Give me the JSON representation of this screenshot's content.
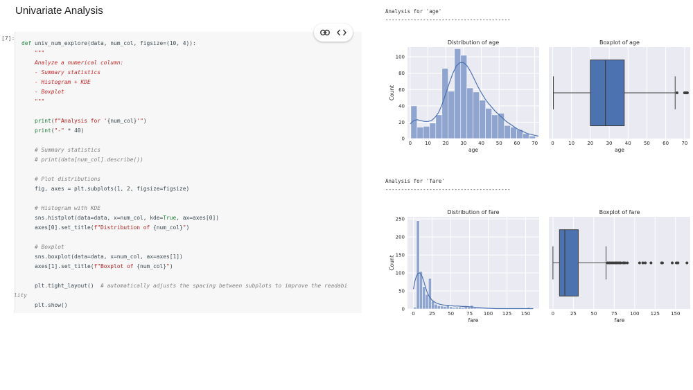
{
  "heading": "Univariate Analysis",
  "cell": {
    "execution_count": "[7]:",
    "code_lines": [
      "<span class=\"kw\">def</span> univ_num_explore(data, num_col, figsize=(10, 4)):",
      "    <span class=\"doc\">\"\"\"</span>",
      "    <span class=\"doc\">Analyze a numerical column:</span>",
      "    <span class=\"doc\">- Summary statistics</span>",
      "    <span class=\"doc\">- Histogram + KDE</span>",
      "    <span class=\"doc\">- Boxplot</span>",
      "    <span class=\"doc\">\"\"\"</span>",
      "",
      "    <span class=\"kw\">print</span>(<span class=\"str\">f\"Analysis for '</span>{num_col}<span class=\"str\">'\"</span>)",
      "    <span class=\"kw\">print</span>(<span class=\"str\">\"-\"</span> * 40)",
      "",
      "    <span class=\"cmt\"># Summary statistics</span>",
      "    <span class=\"cmt\"># print(data[num_col].describe())</span>",
      "",
      "    <span class=\"cmt\"># Plot distributions</span>",
      "    fig, axes = plt.subplots(1, 2, figsize=figsize)",
      "",
      "    <span class=\"cmt\"># Histogram with KDE</span>",
      "    sns.histplot(data=data, x=num_col, kde=<span class=\"kw\">True</span>, ax=axes[0])",
      "    axes[0].set_title(<span class=\"str\">f\"Distribution of </span>{num_col}<span class=\"str\">\"</span>)",
      "",
      "    <span class=\"cmt\"># Boxplot</span>",
      "    sns.boxplot(data=data, x=num_col, ax=axes[1])",
      "    axes[1].set_title(<span class=\"str\">f\"Boxplot of </span>{num_col}<span class=\"str\">\"</span>)",
      "",
      "    plt.tight_layout()  <span class=\"cmt\"># automatically adjusts the spacing between subplots to improve the readabi</span>",
      "<span class=\"cmt\">lity</span>",
      "    plt.show()"
    ],
    "toolbar": {
      "link_icon": "link-icon",
      "code_icon": "code-icon"
    }
  },
  "outputs": {
    "age_title": "Analysis for 'age'",
    "age_rule": "----------------------------------------",
    "fare_title": "Analysis for 'fare'",
    "fare_rule": "----------------------------------------"
  },
  "colors": {
    "bar": "#8fa4cf",
    "box": "#4c72b0",
    "kde": "#4c72b0",
    "bg": "#eaeaf2"
  },
  "chart_data": [
    {
      "type": "bar",
      "title": "Distribution of age",
      "xlabel": "age",
      "ylabel": "Count",
      "xlim": [
        -1.5,
        72.5
      ],
      "ylim": [
        0,
        112
      ],
      "xticks": [
        0,
        10,
        20,
        30,
        40,
        50,
        60,
        70
      ],
      "yticks": [
        0,
        20,
        40,
        60,
        80,
        100
      ],
      "bin_width": 3.5,
      "bin_start": 0.4,
      "values": [
        40,
        14,
        15,
        19,
        29,
        86,
        58,
        110,
        102,
        62,
        57,
        47,
        37,
        29,
        31,
        16,
        14,
        11,
        6,
        3
      ],
      "kde_x": [
        0,
        2,
        4,
        6,
        8,
        10,
        12,
        14,
        16,
        18,
        20,
        22,
        24,
        26,
        28,
        30,
        32,
        34,
        36,
        38,
        40,
        42,
        44,
        46,
        48,
        50,
        52,
        54,
        56,
        58,
        60,
        62,
        64,
        66,
        68,
        70,
        72
      ],
      "kde_y": [
        18,
        22,
        23,
        22,
        21,
        21,
        22,
        26,
        32,
        42,
        55,
        68,
        80,
        89,
        93,
        93,
        89,
        82,
        73,
        64,
        56,
        49,
        43,
        38,
        33,
        29,
        25,
        21,
        18,
        15,
        12,
        10,
        8,
        6,
        5,
        4,
        3
      ],
      "grid": true
    },
    {
      "type": "boxplot",
      "title": "Boxplot of age",
      "xlabel": "age",
      "xlim": [
        -2,
        73
      ],
      "xticks": [
        0,
        10,
        20,
        30,
        40,
        50,
        60,
        70
      ],
      "whisker_low": 0.4,
      "q1": 20,
      "median": 28,
      "q3": 38,
      "whisker_high": 65,
      "outliers": [
        66,
        70,
        70.5,
        71,
        71.5
      ],
      "grid": true
    },
    {
      "type": "bar",
      "title": "Distribution of fare",
      "xlabel": "fare",
      "ylabel": "Count",
      "xlim": [
        -8,
        168
      ],
      "ylim": [
        0,
        256
      ],
      "xticks": [
        0,
        25,
        50,
        75,
        100,
        125,
        150
      ],
      "yticks": [
        0,
        50,
        100,
        150,
        200,
        250
      ],
      "bin_width": 4,
      "bin_start": 0,
      "values": [
        5,
        245,
        104,
        62,
        40,
        85,
        22,
        13,
        9,
        8,
        7,
        12,
        6,
        4,
        5,
        5,
        4,
        7,
        5,
        10,
        3,
        2,
        2,
        2,
        3,
        1,
        1,
        1,
        1,
        1,
        1,
        1,
        1,
        1,
        1,
        1,
        1,
        2,
        4
      ],
      "kde_x": [
        0,
        2,
        4,
        6,
        8,
        10,
        12,
        14,
        16,
        18,
        20,
        25,
        30,
        35,
        40,
        45,
        50,
        55,
        60,
        65,
        70,
        75,
        80,
        85,
        90,
        100,
        110,
        120,
        130,
        140,
        150,
        160
      ],
      "kde_y": [
        55,
        78,
        92,
        98,
        100,
        97,
        88,
        75,
        61,
        48,
        38,
        24,
        17,
        13,
        11,
        10,
        9,
        8,
        8,
        7,
        7,
        6,
        5,
        4,
        3,
        2,
        1,
        1,
        1,
        1,
        1,
        1
      ],
      "grid": true
    },
    {
      "type": "boxplot",
      "title": "Boxplot of fare",
      "xlabel": "fare",
      "xlim": [
        -5,
        168
      ],
      "xticks": [
        0,
        25,
        50,
        75,
        100,
        125,
        150
      ],
      "whisker_low": 0,
      "q1": 8,
      "median": 14.5,
      "q3": 31,
      "whisker_high": 65,
      "outliers": [
        67,
        69,
        71,
        73,
        75,
        77,
        78,
        80,
        82,
        83,
        86,
        88,
        91,
        106,
        110,
        113,
        120,
        133,
        134,
        146,
        151,
        153,
        164
      ],
      "grid": true
    }
  ]
}
